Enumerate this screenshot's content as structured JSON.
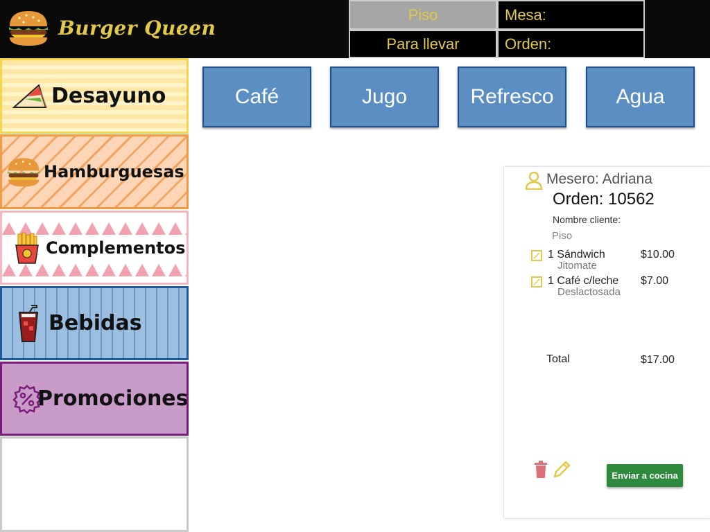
{
  "app": {
    "logo_icon": "burger-icon",
    "title": "Burger Queen"
  },
  "header": {
    "floor_label": "Piso",
    "table_label": "Mesa:",
    "takeaway_label": "Para llevar",
    "order_label": "Orden:"
  },
  "categories": [
    {
      "label": "Desayuno",
      "icon": "sandwich-icon",
      "border": "#f5d54a"
    },
    {
      "label": "Hamburguesas",
      "icon": "burger-icon",
      "border": "#f29a45"
    },
    {
      "label": "Complementos",
      "icon": "fries-icon",
      "border": "#f4b7bf"
    },
    {
      "label": "Bebidas",
      "icon": "soda-icon",
      "border": "#1d5a9a"
    },
    {
      "label": "Promociones",
      "icon": "discount-badge-icon",
      "border": "#7a1d7a"
    }
  ],
  "products": [
    {
      "label": "Café"
    },
    {
      "label": "Jugo"
    },
    {
      "label": "Refresco"
    },
    {
      "label": "Agua"
    }
  ],
  "order": {
    "waiter": "Mesero: Adriana",
    "number": "Orden: 10562",
    "client_label": "Nombre cliente:",
    "mode": "Piso",
    "items": [
      {
        "name": "1 Sándwich",
        "note": "Jitomate",
        "price": "$10.00"
      },
      {
        "name": "1 Café c/leche",
        "note": "Deslactosada",
        "price": "$7.00"
      }
    ],
    "total_label": "Total",
    "total": "$17.00",
    "send_label": "Enviar a cocina"
  },
  "colors": {
    "header_bg": "#0a0a0a",
    "accent_gold": "#e2c94a",
    "product_button": "#5b8fc4",
    "send_button": "#2e8b3e",
    "trash": "#d9707a"
  }
}
